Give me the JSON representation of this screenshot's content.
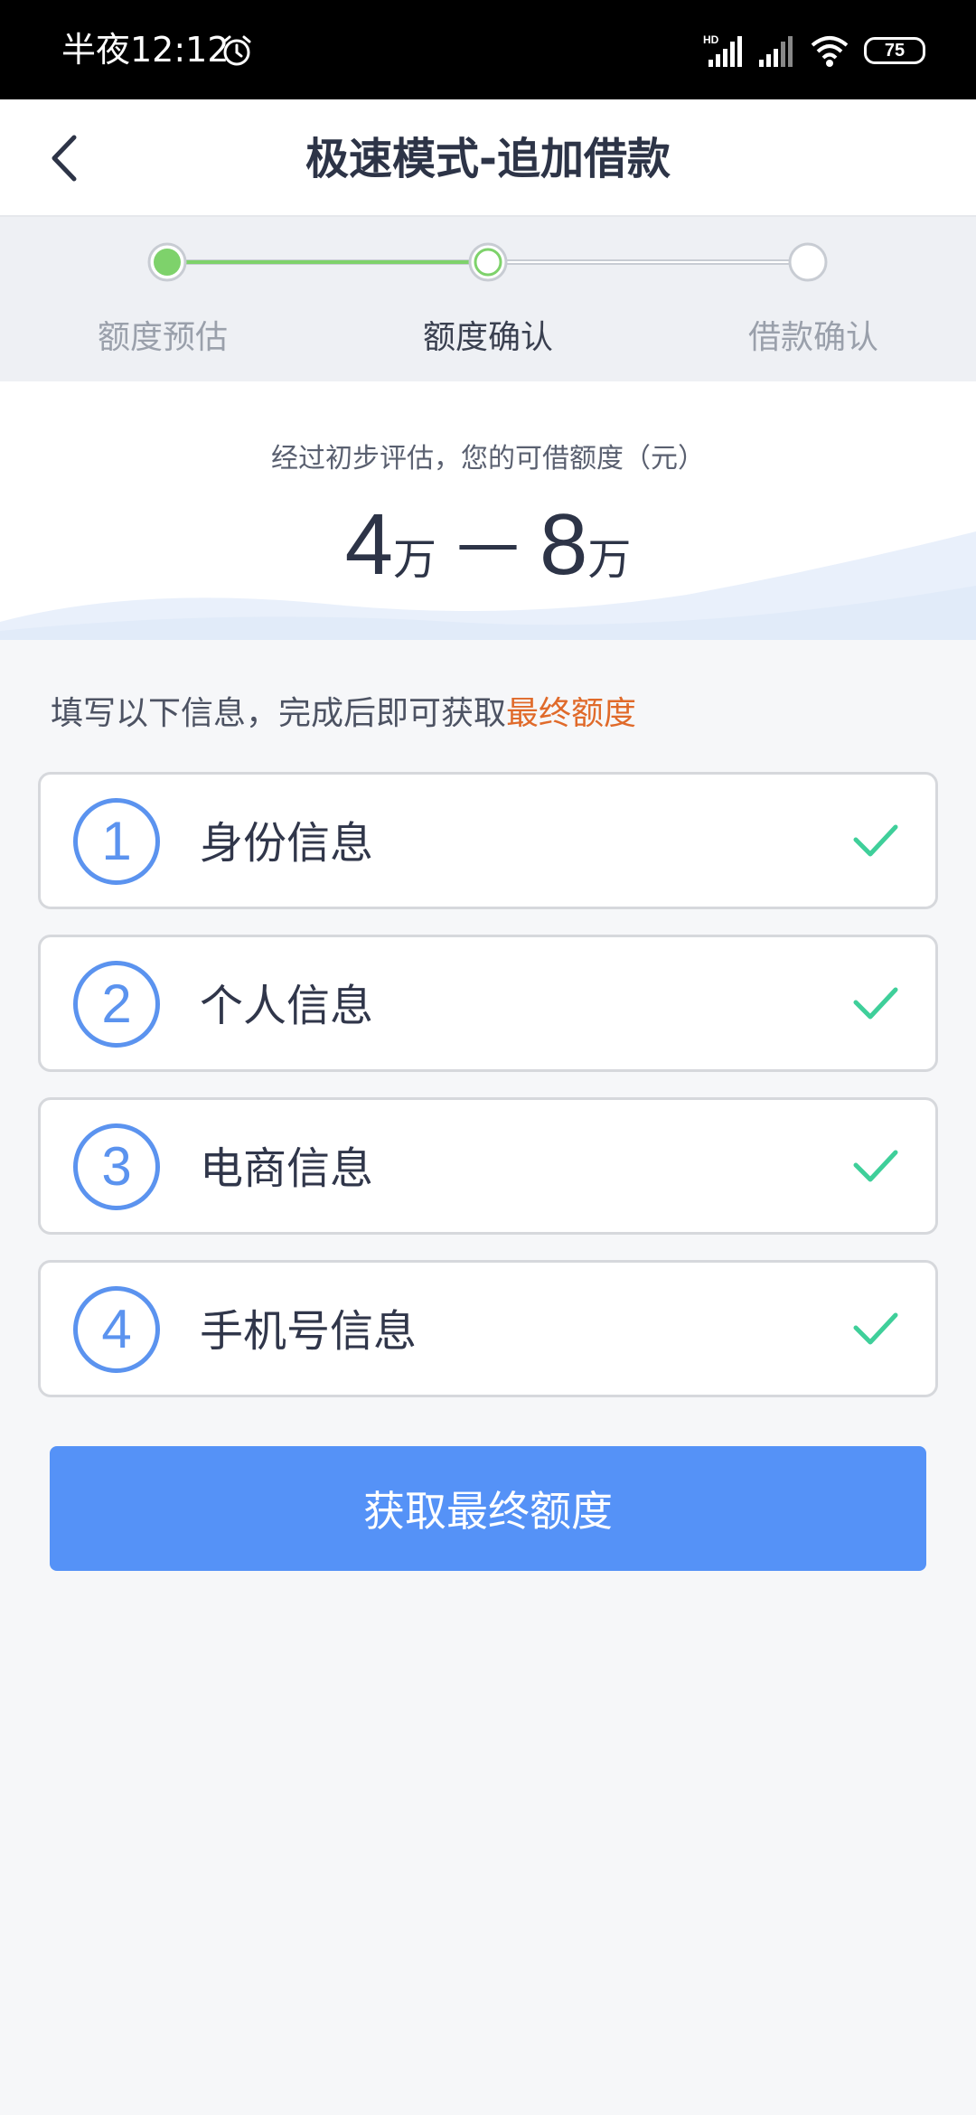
{
  "status_bar": {
    "time": "半夜12:12",
    "battery": "75",
    "icons": [
      "alarm-icon",
      "hd-signal-icon",
      "signal-icon",
      "wifi-icon",
      "battery-icon"
    ]
  },
  "header": {
    "title": "极速模式-追加借款",
    "back_icon": "chevron-left-icon"
  },
  "steps": {
    "items": [
      {
        "label": "额度预估",
        "state": "done"
      },
      {
        "label": "额度确认",
        "state": "current"
      },
      {
        "label": "借款确认",
        "state": "pending"
      }
    ],
    "progress_color": "#7ed26b"
  },
  "quota": {
    "caption": "经过初步评估，您的可借额度（元）",
    "min_value": "4",
    "max_value": "8",
    "unit": "万",
    "separator": "—"
  },
  "prompt": {
    "text": "填写以下信息，完成后即可获取",
    "highlight": "最终额度"
  },
  "info_items": [
    {
      "number": "1",
      "label": "身份信息",
      "completed": true
    },
    {
      "number": "2",
      "label": "个人信息",
      "completed": true
    },
    {
      "number": "3",
      "label": "电商信息",
      "completed": true
    },
    {
      "number": "4",
      "label": "手机号信息",
      "completed": true
    }
  ],
  "action": {
    "button_label": "获取最终额度"
  },
  "colors": {
    "accent_blue": "#5592f7",
    "check_green": "#3fcf9a",
    "highlight_orange": "#e06a2a"
  }
}
